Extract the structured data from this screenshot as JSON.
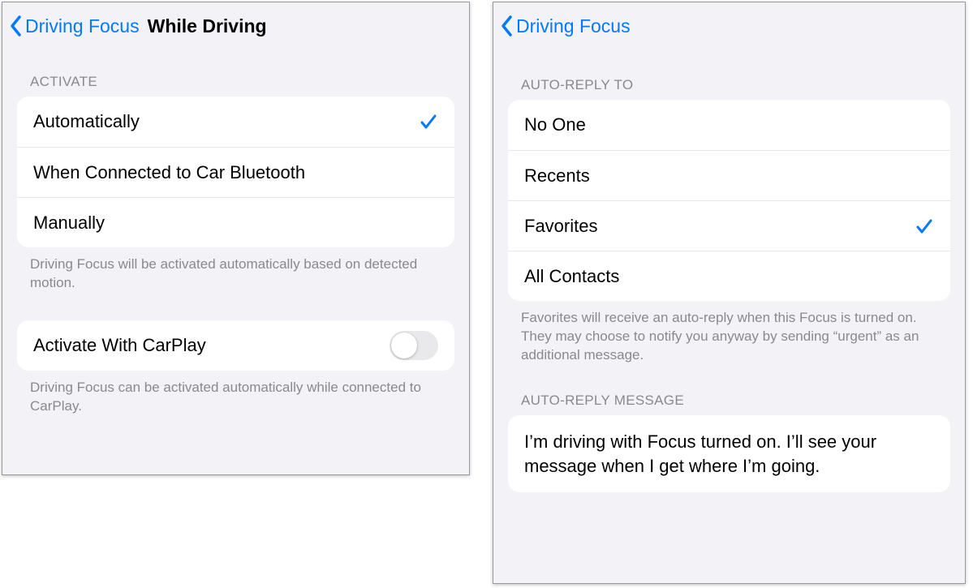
{
  "left": {
    "back_label": "Driving Focus",
    "title": "While Driving",
    "section1_header": "Activate",
    "options": [
      {
        "label": "Automatically",
        "selected": true
      },
      {
        "label": "When Connected to Car Bluetooth",
        "selected": false
      },
      {
        "label": "Manually",
        "selected": false
      }
    ],
    "section1_footer": "Driving Focus will be activated automatically based on detected motion.",
    "carplay_label": "Activate With CarPlay",
    "carplay_on": false,
    "section2_footer": "Driving Focus can be activated automatically while connected to CarPlay."
  },
  "right": {
    "back_label": "Driving Focus",
    "section1_header": "Auto-Reply To",
    "options": [
      {
        "label": "No One",
        "selected": false
      },
      {
        "label": "Recents",
        "selected": false
      },
      {
        "label": "Favorites",
        "selected": true
      },
      {
        "label": "All Contacts",
        "selected": false
      }
    ],
    "section1_footer": "Favorites will receive an auto-reply when this Focus is turned on. They may choose to notify you anyway by sending “urgent” as an additional message.",
    "section2_header": "Auto-Reply Message",
    "message": "I’m driving with Focus turned on. I’ll see your message when I get where I’m going."
  }
}
